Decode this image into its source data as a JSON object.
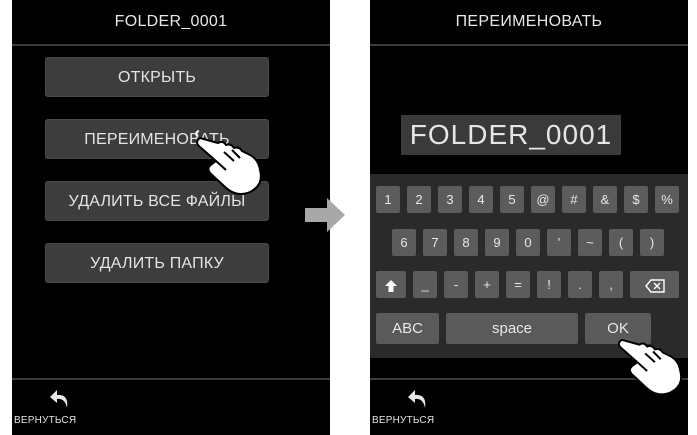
{
  "left_screen": {
    "title": "FOLDER_0001",
    "menu": [
      "ОТКРЫТЬ",
      "ПЕРЕИМЕНОВАТЬ",
      "УДАЛИТЬ ВСЕ ФАЙЛЫ",
      "УДАЛИТЬ ПАПКУ"
    ],
    "back_label": "ВЕРНУТЬСЯ"
  },
  "right_screen": {
    "title": "ПЕРЕИМЕНОВАТЬ",
    "name_value": "FOLDER_0001",
    "keyboard": {
      "row1": [
        "1",
        "2",
        "3",
        "4",
        "5",
        "@",
        "#",
        "&",
        "$",
        "%"
      ],
      "row2": [
        "6",
        "7",
        "8",
        "9",
        "0",
        "'",
        "~",
        "(",
        ")"
      ],
      "row3": [
        "shift-icon",
        "_",
        "-",
        "+",
        "=",
        "!",
        ".",
        ",",
        "backspace-icon"
      ],
      "abc": "ABC",
      "space": "space",
      "ok": "OK"
    },
    "back_label": "ВЕРНУТЬСЯ"
  },
  "colors": {
    "screen_bg": "#000000",
    "button_bg": "#3d3d3d",
    "key_bg": "#5c5c5c",
    "keyboard_bg": "#2a2a2a",
    "arrow": "#a8a8a8"
  }
}
